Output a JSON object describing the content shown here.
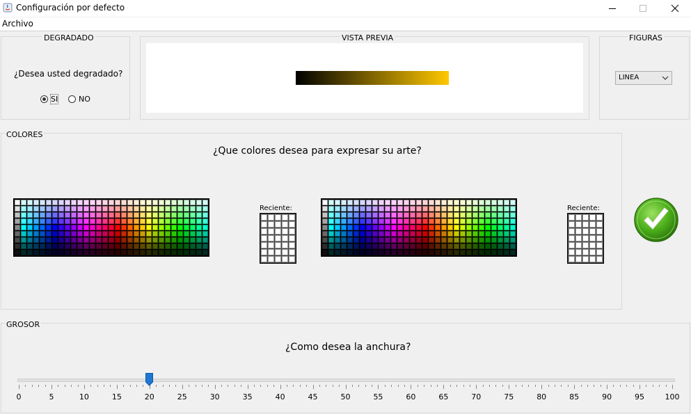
{
  "window": {
    "title": "Configuración por defecto",
    "icons": [
      "java-icon",
      "minimize-icon",
      "maximize-icon",
      "close-icon"
    ]
  },
  "menu": {
    "archivo": "Archivo"
  },
  "degradado": {
    "title": "DEGRADADO",
    "question": "¿Desea usted degradado?",
    "yes": "SI",
    "no": "NO",
    "selected": "SI"
  },
  "preview": {
    "title": "VISTA PREVIA",
    "gradient_start": "#000000",
    "gradient_end": "#ffc800"
  },
  "figuras": {
    "title": "FIGURAS",
    "selected": "LINEA"
  },
  "colores": {
    "title": "COLORES",
    "question": "¿Que colores desea para expresar su arte?",
    "recent_label_1": "Reciente:",
    "recent_label_2": "Reciente:"
  },
  "grosor": {
    "title": "GROSOR",
    "question": "¿Como desea la anchura?",
    "value": 20,
    "min": 0,
    "max": 100,
    "major_tick": 5,
    "labels": [
      "0",
      "5",
      "10",
      "15",
      "20",
      "25",
      "30",
      "35",
      "40",
      "45",
      "50",
      "55",
      "60",
      "65",
      "70",
      "75",
      "80",
      "85",
      "90",
      "95",
      "100"
    ],
    "thumb_color": "#1e78d2"
  },
  "accept": {
    "icon": "checkmark-icon",
    "color": "#4caf1a"
  }
}
